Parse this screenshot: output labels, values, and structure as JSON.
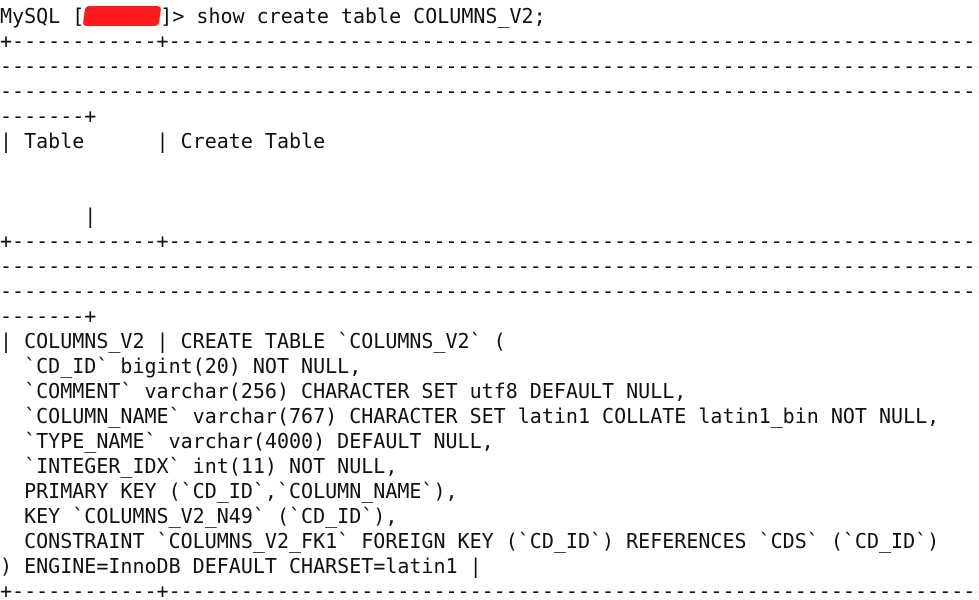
{
  "prompt": {
    "prefix": "MySQL [",
    "suffix": "]> ",
    "command": "show create table COLUMNS_V2;",
    "redaction_color": "#ff1a1a"
  },
  "table": {
    "border_top_segment": "+------------+---------------------------------------------------------------------------------------------------",
    "dash_line": "--------------------------------------------------------------------------------------------------------------",
    "border_tail": "-------+",
    "header_row": "| Table      | Create Table",
    "header_row_end": "       |",
    "row_first": "| COLUMNS_V2 | CREATE TABLE `COLUMNS_V2` (",
    "ddl_lines": [
      "  `CD_ID` bigint(20) NOT NULL,",
      "  `COMMENT` varchar(256) CHARACTER SET utf8 DEFAULT NULL,",
      "  `COLUMN_NAME` varchar(767) CHARACTER SET latin1 COLLATE latin1_bin NOT NULL,",
      "  `TYPE_NAME` varchar(4000) DEFAULT NULL,",
      "  `INTEGER_IDX` int(11) NOT NULL,",
      "  PRIMARY KEY (`CD_ID`,`COLUMN_NAME`),",
      "  KEY `COLUMNS_V2_N49` (`CD_ID`),",
      "  CONSTRAINT `COLUMNS_V2_FK1` FOREIGN KEY (`CD_ID`) REFERENCES `CDS` (`CD_ID`)"
    ],
    "row_end": ") ENGINE=InnoDB DEFAULT CHARSET=latin1 |",
    "border_bottom_segment": "+------------+---------------------------------------------------------------------------------------------------"
  }
}
